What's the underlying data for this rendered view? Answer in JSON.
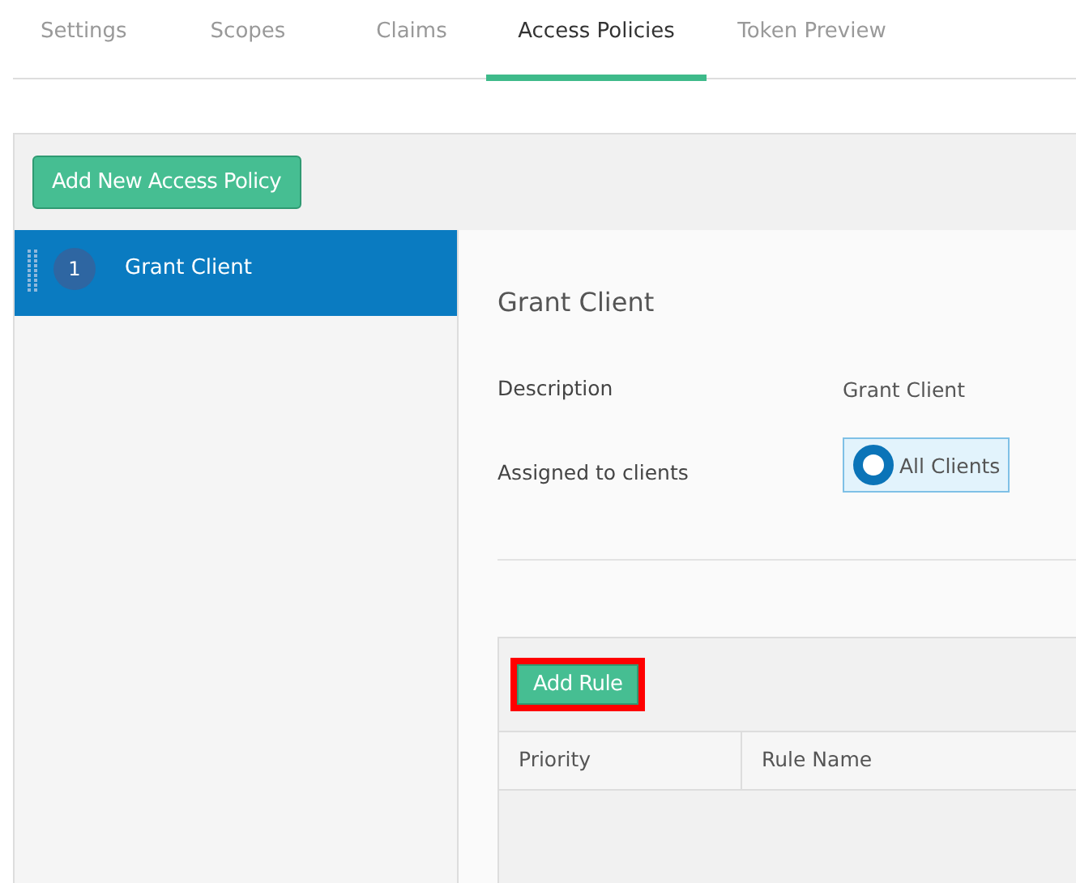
{
  "tabs": [
    {
      "label": "Settings",
      "selected": false
    },
    {
      "label": "Scopes",
      "selected": false
    },
    {
      "label": "Claims",
      "selected": false
    },
    {
      "label": "Access Policies",
      "selected": true
    },
    {
      "label": "Token Preview",
      "selected": false
    }
  ],
  "toolbar": {
    "add_button": "Add New Access Policy"
  },
  "policies": [
    {
      "number": "1",
      "name": "Grant Client",
      "selected": true
    }
  ],
  "detail": {
    "title": "Grant Client",
    "fields": [
      {
        "kind": "text",
        "label": "Description",
        "value": "Grant Client"
      },
      {
        "kind": "chip",
        "label": "Assigned to clients",
        "value": "All Clients"
      }
    ]
  },
  "rules": {
    "add_button": {
      "label": "Add Rule",
      "highlighted": true
    },
    "columns": [
      "Priority",
      "Rule Name"
    ]
  }
}
